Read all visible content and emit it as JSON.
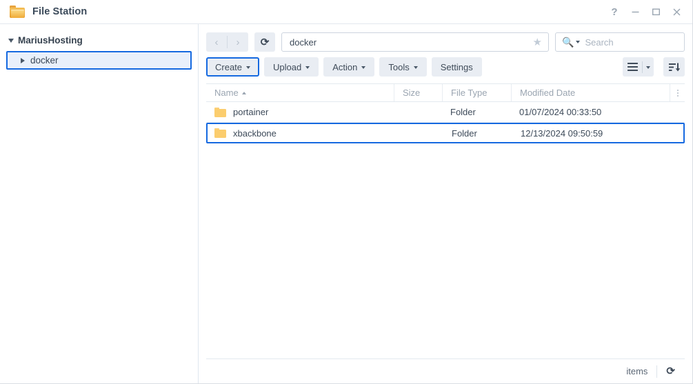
{
  "titlebar": {
    "app_icon": "folder-icon",
    "title": "File Station",
    "help_label": "?",
    "minimize_label": "minimize-icon",
    "maximize_label": "maximize-icon",
    "close_label": "close-icon"
  },
  "sidebar": {
    "root": {
      "label": "MariusHosting",
      "expanded": true
    },
    "items": [
      {
        "label": "docker",
        "selected": true,
        "expanded": false
      }
    ]
  },
  "nav": {
    "back_label": "‹",
    "forward_label": "›",
    "refresh_label": "⟳",
    "path_value": "docker",
    "path_placeholder": "",
    "favorite_icon": "star-icon",
    "search_icon": "search-icon",
    "search_placeholder": "Search",
    "search_value": ""
  },
  "toolbar": {
    "buttons": [
      {
        "label": "Create",
        "has_caret": true,
        "selected": true
      },
      {
        "label": "Upload",
        "has_caret": true,
        "selected": false
      },
      {
        "label": "Action",
        "has_caret": true,
        "selected": false
      },
      {
        "label": "Tools",
        "has_caret": true,
        "selected": false
      },
      {
        "label": "Settings",
        "has_caret": false,
        "selected": false
      }
    ],
    "view_mode_icon": "list-view-icon",
    "view_mode_caret": "chevron-down-icon",
    "sort_icon": "sort-descending-icon"
  },
  "table": {
    "columns": [
      {
        "key": "name",
        "label": "Name",
        "sorted": "asc"
      },
      {
        "key": "size",
        "label": "Size",
        "sorted": ""
      },
      {
        "key": "type",
        "label": "File Type",
        "sorted": ""
      },
      {
        "key": "date",
        "label": "Modified Date",
        "sorted": ""
      }
    ],
    "column_options_icon": "kebab-menu-icon",
    "rows": [
      {
        "icon": "folder-icon",
        "name": "portainer",
        "size": "",
        "type": "Folder",
        "date": "01/07/2024 00:33:50",
        "highlighted": false
      },
      {
        "icon": "folder-icon",
        "name": "xbackbone",
        "size": "",
        "type": "Folder",
        "date": "12/13/2024 09:50:59",
        "highlighted": true
      }
    ]
  },
  "statusbar": {
    "items_text": "items",
    "refresh_icon": "refresh-icon"
  },
  "colors": {
    "accent_blue": "#1569e0",
    "selection_fill": "#e9f0fb",
    "button_grey": "#e9edf3",
    "folder_yellow": "#fbcd6e",
    "text_dark": "#3d4a59",
    "text_muted": "#9aa5b1"
  }
}
